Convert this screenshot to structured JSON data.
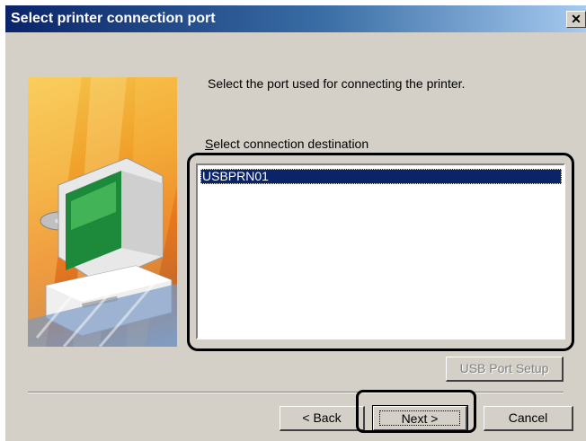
{
  "dialog": {
    "title": "Select printer connection port",
    "close_symbol": "✕"
  },
  "instruction": "Select the port used for connecting the printer.",
  "list": {
    "label_mnemonic": "S",
    "label_rest": "elect connection destination",
    "items": [
      "USBPRN01"
    ],
    "selected_index": 0
  },
  "buttons": {
    "usb_port_setup": "USB Port Setup",
    "back": "< Back",
    "next": "Next >",
    "cancel": "Cancel"
  },
  "icons": {
    "side_art": "computer-illustration-icon",
    "close": "close-icon"
  },
  "colors": {
    "title_bar": "#0a246a",
    "selection": "#0a246a",
    "dialog_face": "#d4d0c8"
  }
}
